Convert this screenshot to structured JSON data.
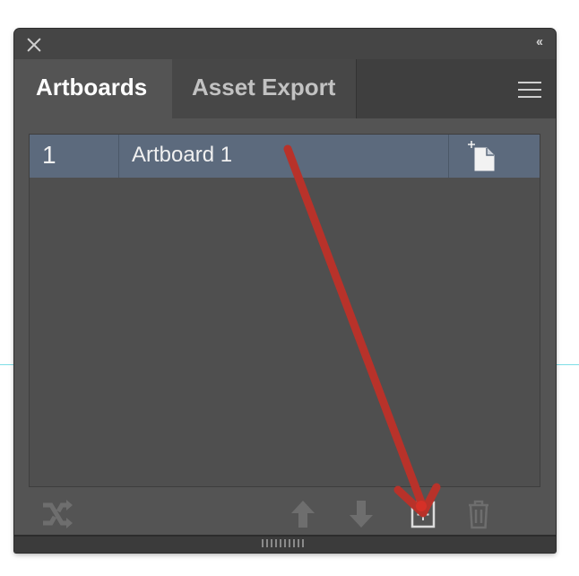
{
  "panel": {
    "tabs": [
      {
        "label": "Artboards",
        "active": true
      },
      {
        "label": "Asset Export",
        "active": false
      }
    ]
  },
  "artboards": [
    {
      "number": "1",
      "name": "Artboard 1",
      "selected": true
    }
  ],
  "toolbar": {
    "buttons": [
      {
        "icon": "rearrange-icon",
        "enabled": false
      },
      {
        "icon": "move-up-icon",
        "enabled": false
      },
      {
        "icon": "move-down-icon",
        "enabled": false
      },
      {
        "icon": "new-artboard-icon",
        "enabled": true
      },
      {
        "icon": "delete-icon",
        "enabled": false
      }
    ]
  },
  "annotation": {
    "type": "arrow",
    "color": "#b8322a",
    "points_to": "new-artboard-button"
  },
  "colors": {
    "panel_background": "#545454",
    "selected_row": "#5c6a7d",
    "guide_line": "#7fdde6"
  }
}
